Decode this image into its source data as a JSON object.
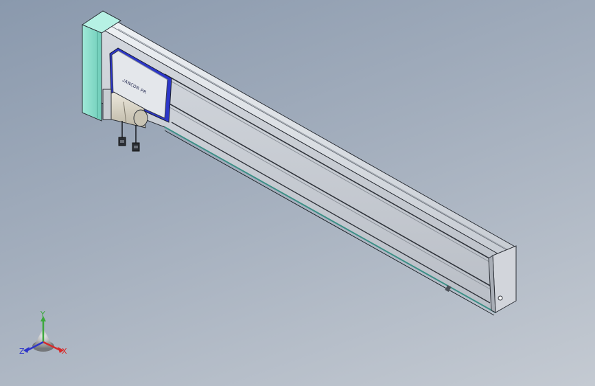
{
  "viewport": {
    "background_top": "#8a99ad",
    "background_bottom": "#c4cad2"
  },
  "model": {
    "parts": [
      "linear-module-rail",
      "motor-side-end-block",
      "carriage-slider-plate",
      "servo-motor",
      "motor-cable-connectors",
      "far-end-cap",
      "mounting-hole"
    ],
    "colors": {
      "rail_top": "#d8dde3",
      "rail_side": "#c3c8cf",
      "rail_edge": "#2b2f36",
      "end_block": "#8fe0cf",
      "carriage_face": "#e3e6ea",
      "carriage_trim": "#2c36c9",
      "motor_body": "#dcd7c8",
      "end_cap": "#cfd2d8"
    }
  },
  "carriage": {
    "logo_text": "ᴊᴀɴᴄᴏʀ ᴘʀ"
  },
  "triad": {
    "x_label": "X",
    "y_label": "Y",
    "z_label": "Z",
    "x_color": "#d62b2b",
    "y_color": "#3ca83c",
    "z_color": "#2e35c9"
  }
}
